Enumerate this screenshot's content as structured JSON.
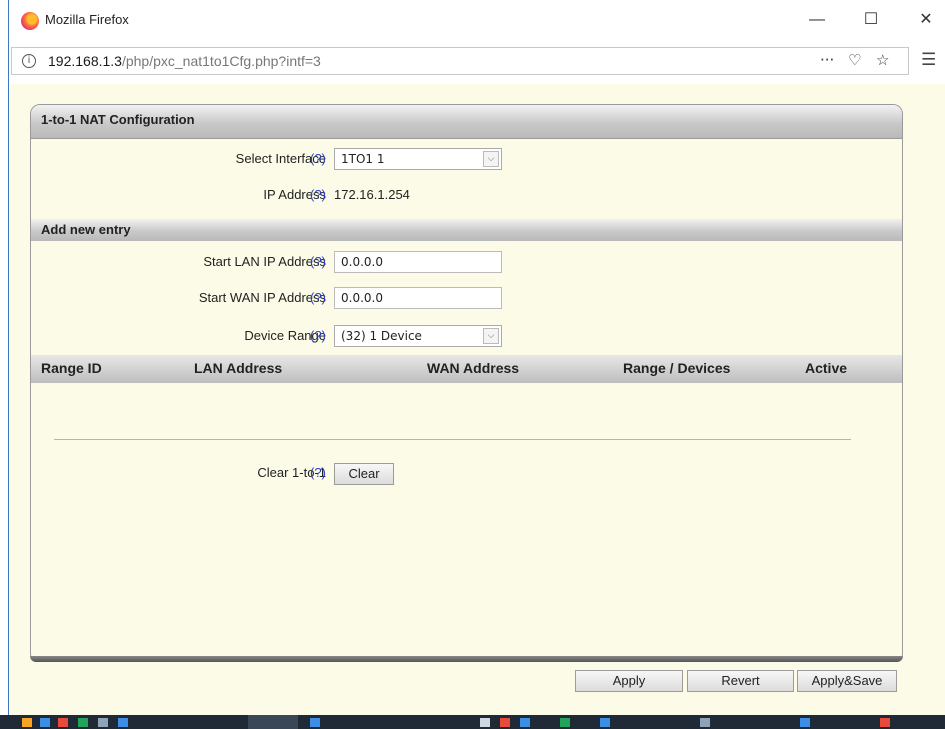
{
  "window": {
    "title": "Mozilla Firefox"
  },
  "urlbar": {
    "host": "192.168.1.3",
    "path": "/php/pxc_nat1to1Cfg.php?intf=3"
  },
  "panel": {
    "title": "1-to-1 NAT Configuration",
    "help_symbol": "(?)",
    "select_interface": {
      "label": "Select Interface",
      "value": "1TO1 1"
    },
    "ip_address": {
      "label": "IP Address",
      "value": "172.16.1.254"
    },
    "add_entry": {
      "title": "Add new entry",
      "start_lan": {
        "label": "Start LAN IP Address",
        "value": "0.0.0.0"
      },
      "start_wan": {
        "label": "Start WAN IP Address",
        "value": "0.0.0.0"
      },
      "device_range": {
        "label": "Device Range",
        "value": "(32) 1 Device"
      }
    },
    "table": {
      "columns": [
        "Range ID",
        "LAN Address",
        "WAN Address",
        "Range / Devices",
        "Active"
      ]
    },
    "clear": {
      "label": "Clear 1-to-1",
      "button": "Clear"
    }
  },
  "footer": {
    "apply": "Apply",
    "revert": "Revert",
    "apply_save": "Apply&Save"
  }
}
